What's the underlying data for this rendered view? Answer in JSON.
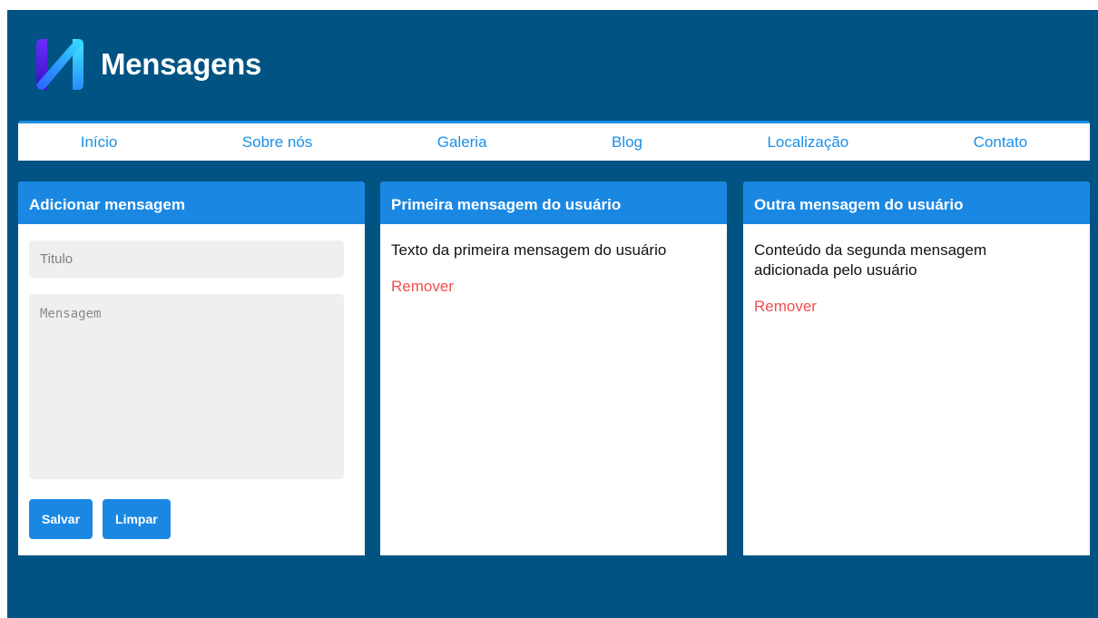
{
  "header": {
    "title": "Mensagens",
    "logo_icon": "m-logo-icon"
  },
  "nav": {
    "items": [
      "Início",
      "Sobre nós",
      "Galeria",
      "Blog",
      "Localização",
      "Contato"
    ]
  },
  "add_card": {
    "title": "Adicionar mensagem",
    "title_placeholder": "Titulo",
    "message_placeholder": "Mensagem",
    "save_label": "Salvar",
    "clear_label": "Limpar"
  },
  "messages": [
    {
      "title": "Primeira mensagem do usuário",
      "text": "Texto da primeira mensagem do usuário",
      "remove_label": "Remover"
    },
    {
      "title": "Outra mensagem do usuário",
      "text": "Conteúdo da segunda mensagem adicionada pelo usuário",
      "remove_label": "Remover"
    }
  ],
  "colors": {
    "background": "#005382",
    "accent": "#1a88e3",
    "danger": "#f24d4d"
  }
}
